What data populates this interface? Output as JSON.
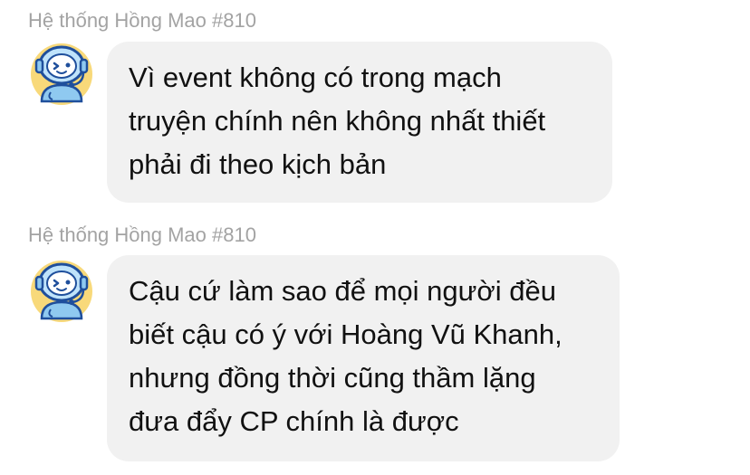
{
  "messages": [
    {
      "sender": "Hệ thống Hồng Mao #810",
      "avatar_icon": "robot-mascot-icon",
      "lines": [
        "Vì event không có trong mạch",
        "truyện chính nên không nhất thiết",
        "phải đi theo kịch bản"
      ]
    },
    {
      "sender": "Hệ thống Hồng Mao #810",
      "avatar_icon": "robot-mascot-icon",
      "lines": [
        "Cậu cứ làm sao để mọi người đều",
        "biết cậu có ý với Hoàng Vũ Khanh,",
        "nhưng đồng thời cũng thầm lặng",
        "đưa đẩy CP chính là được"
      ]
    }
  ],
  "colors": {
    "bubble_background": "#f1f1f1",
    "sender_text": "#a3a3a3",
    "message_text": "#111111",
    "avatar_circle": "#f8d97a",
    "avatar_body": "#8fc9f0",
    "avatar_outline": "#1f4f9c"
  }
}
